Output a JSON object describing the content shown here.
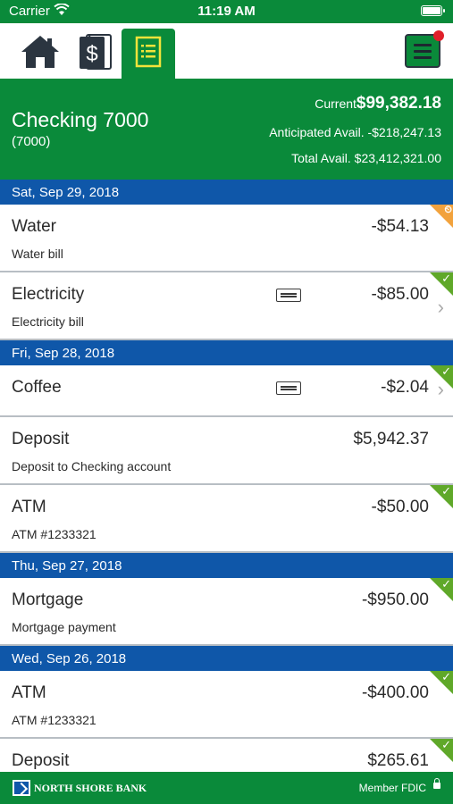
{
  "status_bar": {
    "carrier": "Carrier",
    "time": "11:19 AM"
  },
  "nav": {
    "tabs": [
      {
        "icon": "home-icon",
        "active": false
      },
      {
        "icon": "accounts-icon",
        "active": false
      },
      {
        "icon": "register-icon",
        "active": true
      }
    ],
    "menu_icon": "menu-icon",
    "notification": true
  },
  "account": {
    "name": "Checking 7000",
    "number": "(7000)",
    "current_label": "Current",
    "current_amount": "$99,382.18",
    "anticipated": "Anticipated Avail. -$218,247.13",
    "total": "Total Avail. $23,412,321.00"
  },
  "days": [
    {
      "date": "Sat, Sep 29, 2018",
      "transactions": [
        {
          "name": "Water",
          "memo": "Water bill",
          "amount": "-$54.13",
          "status": "pending",
          "receipt": false,
          "chevron": false
        },
        {
          "name": "Electricity",
          "memo": "Electricity bill",
          "amount": "-$85.00",
          "status": "cleared",
          "receipt": true,
          "chevron": true
        }
      ]
    },
    {
      "date": "Fri, Sep 28, 2018",
      "transactions": [
        {
          "name": "Coffee",
          "memo": "",
          "amount": "-$2.04",
          "status": "cleared",
          "receipt": true,
          "chevron": true
        },
        {
          "name": "Deposit",
          "memo": "Deposit to Checking account",
          "amount": "$5,942.37",
          "status": "none",
          "receipt": false,
          "chevron": false
        },
        {
          "name": "ATM",
          "memo": "ATM #1233321",
          "amount": "-$50.00",
          "status": "cleared",
          "receipt": false,
          "chevron": false
        }
      ]
    },
    {
      "date": "Thu, Sep 27, 2018",
      "transactions": [
        {
          "name": "Mortgage",
          "memo": "Mortgage payment",
          "amount": "-$950.00",
          "status": "cleared",
          "receipt": false,
          "chevron": false
        }
      ]
    },
    {
      "date": "Wed, Sep 26, 2018",
      "transactions": [
        {
          "name": "ATM",
          "memo": "ATM #1233321",
          "amount": "-$400.00",
          "status": "cleared",
          "receipt": false,
          "chevron": false
        },
        {
          "name": "Deposit",
          "memo": "",
          "amount": "$265.61",
          "status": "cleared",
          "receipt": false,
          "chevron": false
        }
      ]
    }
  ],
  "footer": {
    "bank_name": "NORTH SHORE BANK",
    "fdic": "Member FDIC"
  },
  "colors": {
    "green": "#0a8a3a",
    "blue": "#0f57a9",
    "cleared": "#5fa829",
    "pending": "#f2a23c"
  }
}
